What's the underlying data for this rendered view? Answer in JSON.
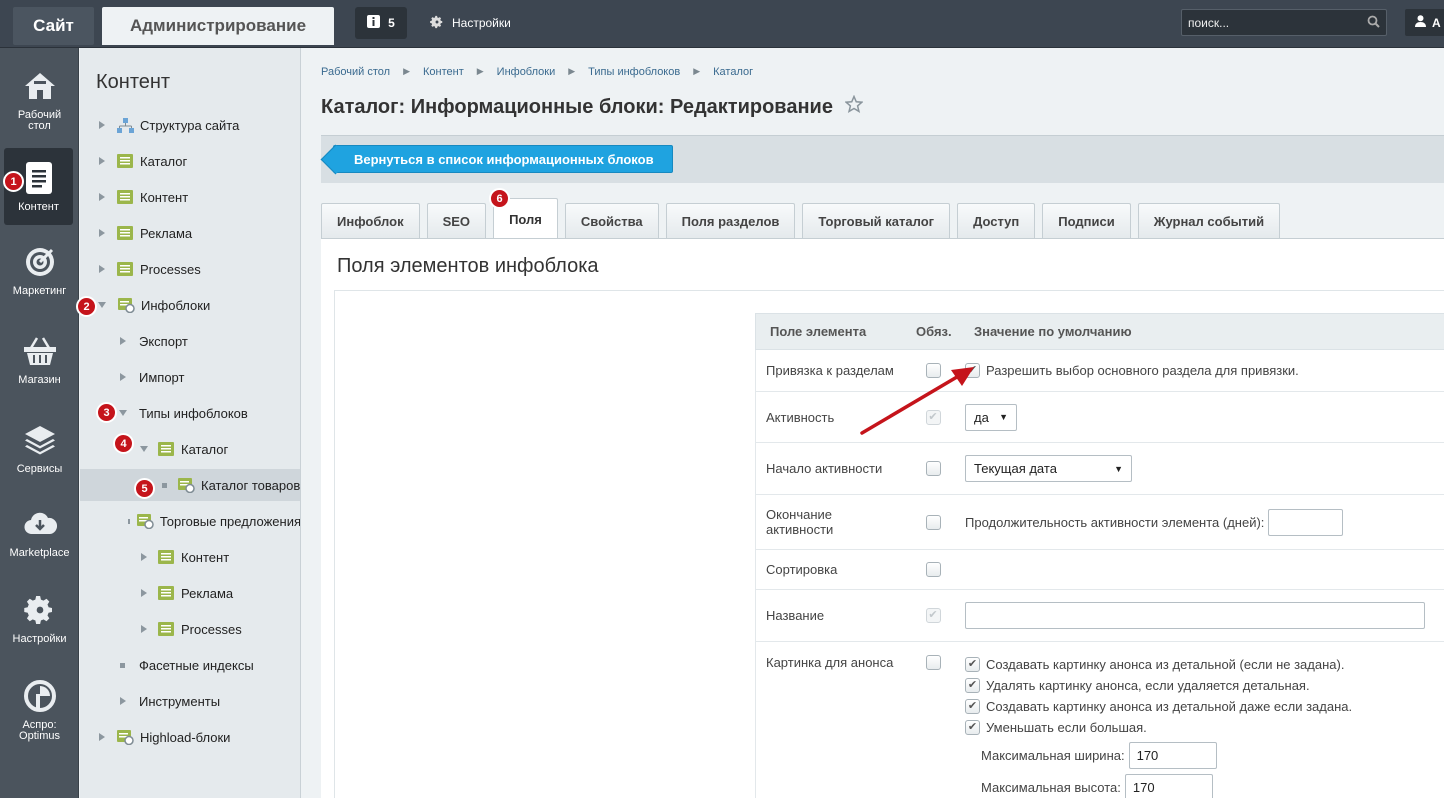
{
  "topbar": {
    "site_label": "Сайт",
    "admin_label": "Администрирование",
    "notifications_count": "5",
    "settings_label": "Настройки",
    "search_placeholder": "поиск..."
  },
  "left_menu": [
    {
      "label": "Рабочий стол",
      "icon": "home-icon"
    },
    {
      "label": "Контент",
      "icon": "document-icon",
      "active": true
    },
    {
      "label": "Маркетинг",
      "icon": "target-icon"
    },
    {
      "label": "Магазин",
      "icon": "basket-icon"
    },
    {
      "label": "Сервисы",
      "icon": "layers-icon"
    },
    {
      "label": "Marketplace",
      "icon": "cloud-download-icon"
    },
    {
      "label": "Настройки",
      "icon": "gear-icon"
    },
    {
      "label": "Аспро: Optimus",
      "icon": "aspro-logo-icon"
    }
  ],
  "tree": {
    "title": "Контент",
    "items": [
      {
        "label": "Структура сайта"
      },
      {
        "label": "Каталог"
      },
      {
        "label": "Контент"
      },
      {
        "label": "Реклама"
      },
      {
        "label": "Processes"
      },
      {
        "label": "Инфоблоки"
      },
      {
        "label": "Экспорт"
      },
      {
        "label": "Импорт"
      },
      {
        "label": "Типы инфоблоков"
      },
      {
        "label": "Каталог"
      },
      {
        "label": "Каталог товаров"
      },
      {
        "label": "Торговые предложения"
      },
      {
        "label": "Контент"
      },
      {
        "label": "Реклама"
      },
      {
        "label": "Processes"
      },
      {
        "label": "Фасетные индексы"
      },
      {
        "label": "Инструменты"
      },
      {
        "label": "Highload-блоки"
      }
    ]
  },
  "annotations": [
    "1",
    "2",
    "3",
    "4",
    "5",
    "6"
  ],
  "breadcrumb": [
    "Рабочий стол",
    "Контент",
    "Инфоблоки",
    "Типы инфоблоков",
    "Каталог"
  ],
  "page_title": "Каталог: Информационные блоки: Редактирование",
  "back_button": "Вернуться в список информационных блоков",
  "tabs": [
    "Инфоблок",
    "SEO",
    "Поля",
    "Свойства",
    "Поля разделов",
    "Торговый каталог",
    "Доступ",
    "Подписи",
    "Журнал событий"
  ],
  "section_title": "Поля элементов инфоблока",
  "grid": {
    "headers": [
      "Поле элемента",
      "Обяз.",
      "Значение по умолчанию"
    ],
    "rows": {
      "sections": {
        "label": "Привязка к разделам",
        "option": "Разрешить выбор основного раздела для привязки."
      },
      "active": {
        "label": "Активность",
        "value": "да"
      },
      "active_from": {
        "label": "Начало активности",
        "value": "Текущая дата"
      },
      "active_to": {
        "label_line1": "Окончание",
        "label_line2": "активности",
        "text": "Продолжительность активности элемента (дней):",
        "value": ""
      },
      "sort": {
        "label": "Сортировка"
      },
      "name": {
        "label": "Название",
        "value": ""
      },
      "preview_picture": {
        "label": "Картинка для анонса",
        "options": [
          "Создавать картинку анонса из детальной (если не задана).",
          "Удалять картинку анонса, если удаляется детальная.",
          "Создавать картинку анонса из детальной даже если задана.",
          "Уменьшать если большая."
        ],
        "max_width_label": "Максимальная ширина:",
        "max_width": "170",
        "max_height_label": "Максимальная высота:",
        "max_height": "170"
      }
    }
  },
  "colors": {
    "annotation_red": "#c5141b",
    "accent_blue": "#1fa3e0",
    "topbar": "#3d4651"
  }
}
